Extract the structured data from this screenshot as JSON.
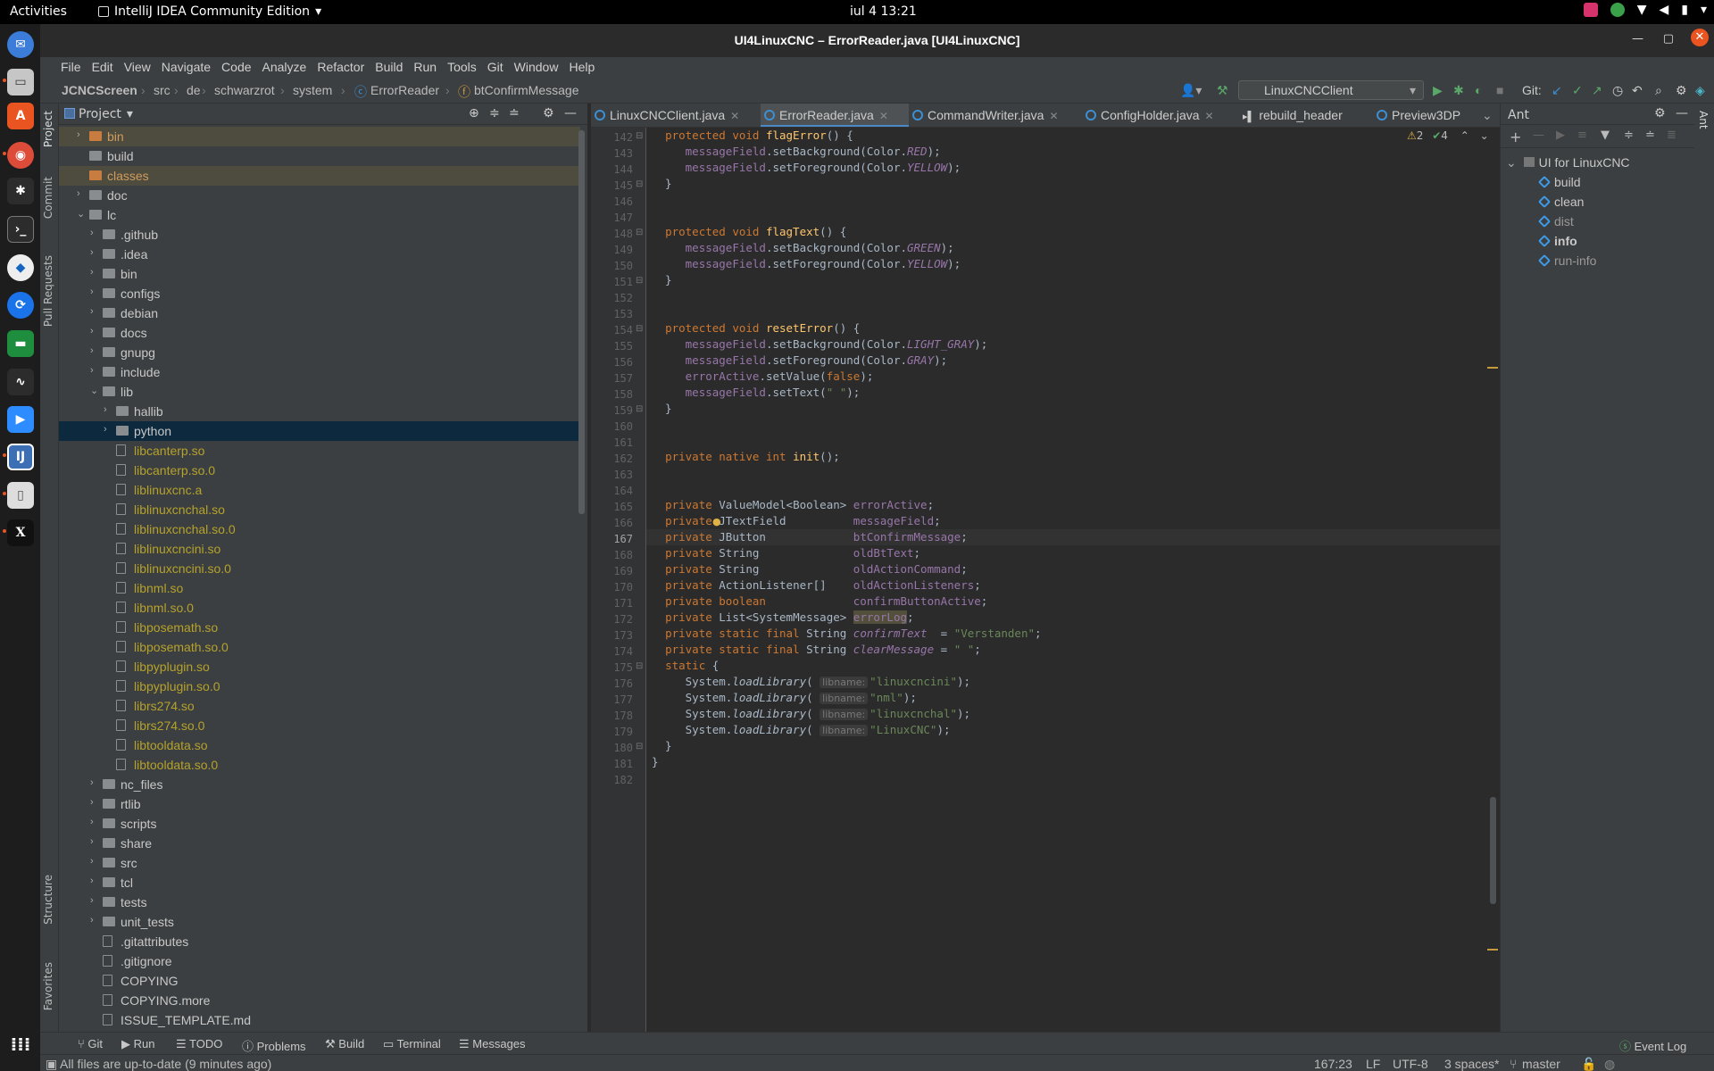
{
  "system": {
    "activities": "Activities",
    "app_name": "IntelliJ IDEA Community Edition",
    "clock": "iul 4  13:21"
  },
  "window": {
    "title": "UI4LinuxCNC – ErrorReader.java [UI4LinuxCNC]"
  },
  "menu": [
    "File",
    "Edit",
    "View",
    "Navigate",
    "Code",
    "Analyze",
    "Refactor",
    "Build",
    "Run",
    "Tools",
    "Git",
    "Window",
    "Help"
  ],
  "breadcrumb": [
    "JCNCScreen",
    "src",
    "de",
    "schwarzrot",
    "system",
    "ErrorReader",
    "btConfirmMessage"
  ],
  "toolbar": {
    "run_config": "LinuxCNCClient",
    "git_label": "Git:"
  },
  "left_tabs": {
    "project": "Project",
    "commit": "Commit",
    "pull_requests": "Pull Requests",
    "structure": "Structure",
    "favorites": "Favorites"
  },
  "project_panel": {
    "title": "Project",
    "rows": [
      {
        "label": "bin",
        "depth": 1,
        "arrow": "›",
        "kind": "folder-ex",
        "style": "excluded"
      },
      {
        "label": "build",
        "depth": 1,
        "arrow": "",
        "kind": "folder",
        "style": ""
      },
      {
        "label": "classes",
        "depth": 1,
        "arrow": "",
        "kind": "folder-ex",
        "style": "excluded"
      },
      {
        "label": "doc",
        "depth": 1,
        "arrow": "›",
        "kind": "folder",
        "style": ""
      },
      {
        "label": "lc",
        "depth": 1,
        "arrow": "⌄",
        "kind": "folder",
        "style": ""
      },
      {
        "label": ".github",
        "depth": 2,
        "arrow": "›",
        "kind": "folder",
        "style": ""
      },
      {
        "label": ".idea",
        "depth": 2,
        "arrow": "›",
        "kind": "folder",
        "style": ""
      },
      {
        "label": "bin",
        "depth": 2,
        "arrow": "›",
        "kind": "folder",
        "style": ""
      },
      {
        "label": "configs",
        "depth": 2,
        "arrow": "›",
        "kind": "folder",
        "style": ""
      },
      {
        "label": "debian",
        "depth": 2,
        "arrow": "›",
        "kind": "folder",
        "style": ""
      },
      {
        "label": "docs",
        "depth": 2,
        "arrow": "›",
        "kind": "folder",
        "style": ""
      },
      {
        "label": "gnupg",
        "depth": 2,
        "arrow": "›",
        "kind": "folder",
        "style": ""
      },
      {
        "label": "include",
        "depth": 2,
        "arrow": "›",
        "kind": "folder",
        "style": ""
      },
      {
        "label": "lib",
        "depth": 2,
        "arrow": "⌄",
        "kind": "folder",
        "style": ""
      },
      {
        "label": "hallib",
        "depth": 3,
        "arrow": "›",
        "kind": "folder",
        "style": ""
      },
      {
        "label": "python",
        "depth": 3,
        "arrow": "›",
        "kind": "folder",
        "style": "selected"
      },
      {
        "label": "libcanterp.so",
        "depth": 3,
        "arrow": "",
        "kind": "file",
        "style": "yellow"
      },
      {
        "label": "libcanterp.so.0",
        "depth": 3,
        "arrow": "",
        "kind": "file",
        "style": "yellow"
      },
      {
        "label": "liblinuxcnc.a",
        "depth": 3,
        "arrow": "",
        "kind": "file",
        "style": "yellow"
      },
      {
        "label": "liblinuxcnchal.so",
        "depth": 3,
        "arrow": "",
        "kind": "file",
        "style": "yellow"
      },
      {
        "label": "liblinuxcnchal.so.0",
        "depth": 3,
        "arrow": "",
        "kind": "file",
        "style": "yellow"
      },
      {
        "label": "liblinuxcncini.so",
        "depth": 3,
        "arrow": "",
        "kind": "file",
        "style": "yellow"
      },
      {
        "label": "liblinuxcncini.so.0",
        "depth": 3,
        "arrow": "",
        "kind": "file",
        "style": "yellow"
      },
      {
        "label": "libnml.so",
        "depth": 3,
        "arrow": "",
        "kind": "file",
        "style": "yellow"
      },
      {
        "label": "libnml.so.0",
        "depth": 3,
        "arrow": "",
        "kind": "file",
        "style": "yellow"
      },
      {
        "label": "libposemath.so",
        "depth": 3,
        "arrow": "",
        "kind": "file",
        "style": "yellow"
      },
      {
        "label": "libposemath.so.0",
        "depth": 3,
        "arrow": "",
        "kind": "file",
        "style": "yellow"
      },
      {
        "label": "libpyplugin.so",
        "depth": 3,
        "arrow": "",
        "kind": "file",
        "style": "yellow"
      },
      {
        "label": "libpyplugin.so.0",
        "depth": 3,
        "arrow": "",
        "kind": "file",
        "style": "yellow"
      },
      {
        "label": "librs274.so",
        "depth": 3,
        "arrow": "",
        "kind": "file",
        "style": "yellow"
      },
      {
        "label": "librs274.so.0",
        "depth": 3,
        "arrow": "",
        "kind": "file",
        "style": "yellow"
      },
      {
        "label": "libtooldata.so",
        "depth": 3,
        "arrow": "",
        "kind": "file",
        "style": "yellow"
      },
      {
        "label": "libtooldata.so.0",
        "depth": 3,
        "arrow": "",
        "kind": "file",
        "style": "yellow"
      },
      {
        "label": "nc_files",
        "depth": 2,
        "arrow": "›",
        "kind": "folder",
        "style": ""
      },
      {
        "label": "rtlib",
        "depth": 2,
        "arrow": "›",
        "kind": "folder",
        "style": ""
      },
      {
        "label": "scripts",
        "depth": 2,
        "arrow": "›",
        "kind": "folder",
        "style": ""
      },
      {
        "label": "share",
        "depth": 2,
        "arrow": "›",
        "kind": "folder",
        "style": ""
      },
      {
        "label": "src",
        "depth": 2,
        "arrow": "›",
        "kind": "folder",
        "style": ""
      },
      {
        "label": "tcl",
        "depth": 2,
        "arrow": "›",
        "kind": "folder",
        "style": ""
      },
      {
        "label": "tests",
        "depth": 2,
        "arrow": "›",
        "kind": "folder",
        "style": ""
      },
      {
        "label": "unit_tests",
        "depth": 2,
        "arrow": "›",
        "kind": "folder",
        "style": ""
      },
      {
        "label": ".gitattributes",
        "depth": 2,
        "arrow": "",
        "kind": "file",
        "style": ""
      },
      {
        "label": ".gitignore",
        "depth": 2,
        "arrow": "",
        "kind": "file",
        "style": ""
      },
      {
        "label": "COPYING",
        "depth": 2,
        "arrow": "",
        "kind": "file",
        "style": ""
      },
      {
        "label": "COPYING.more",
        "depth": 2,
        "arrow": "",
        "kind": "file",
        "style": ""
      },
      {
        "label": "ISSUE_TEMPLATE.md",
        "depth": 2,
        "arrow": "",
        "kind": "file",
        "style": ""
      }
    ]
  },
  "editor_tabs": [
    {
      "label": "LinuxCNCClient.java",
      "active": false
    },
    {
      "label": "ErrorReader.java",
      "active": true
    },
    {
      "label": "CommandWriter.java",
      "active": false
    },
    {
      "label": "ConfigHolder.java",
      "active": false
    },
    {
      "label": "rebuild_header",
      "active": false
    },
    {
      "label": "Preview3DP",
      "active": false
    }
  ],
  "inspections": {
    "warnings": "2",
    "ok": "4"
  },
  "editor": {
    "current_line": 167,
    "lines": [
      {
        "n": 142,
        "html": "  <span class='kw'>protected void </span><span class='fn'>flagError</span>() {"
      },
      {
        "n": 143,
        "html": "     <span class='fld'>messageField</span>.setBackground(Color.<span class='fld-i'>RED</span>);"
      },
      {
        "n": 144,
        "html": "     <span class='fld'>messageField</span>.setForeground(Color.<span class='fld-i'>YELLOW</span>);"
      },
      {
        "n": 145,
        "html": "  }"
      },
      {
        "n": 146,
        "html": ""
      },
      {
        "n": 147,
        "html": ""
      },
      {
        "n": 148,
        "html": "  <span class='kw'>protected void </span><span class='fn'>flagText</span>() {"
      },
      {
        "n": 149,
        "html": "     <span class='fld'>messageField</span>.setBackground(Color.<span class='fld-i'>GREEN</span>);"
      },
      {
        "n": 150,
        "html": "     <span class='fld'>messageField</span>.setForeground(Color.<span class='fld-i'>YELLOW</span>);"
      },
      {
        "n": 151,
        "html": "  }"
      },
      {
        "n": 152,
        "html": ""
      },
      {
        "n": 153,
        "html": ""
      },
      {
        "n": 154,
        "html": "  <span class='kw'>protected void </span><span class='fn'>resetError</span>() {"
      },
      {
        "n": 155,
        "html": "     <span class='fld'>messageField</span>.setBackground(Color.<span class='fld-i'>LIGHT_GRAY</span>);"
      },
      {
        "n": 156,
        "html": "     <span class='fld'>messageField</span>.setForeground(Color.<span class='fld-i'>GRAY</span>);"
      },
      {
        "n": 157,
        "html": "     <span class='fld'>errorActive</span>.setValue(<span class='kw'>false</span>);"
      },
      {
        "n": 158,
        "html": "     <span class='fld'>messageField</span>.setText(<span class='st'>\" \"</span>);"
      },
      {
        "n": 159,
        "html": "  }"
      },
      {
        "n": 160,
        "html": ""
      },
      {
        "n": 161,
        "html": ""
      },
      {
        "n": 162,
        "html": "  <span class='kw'>private native int </span><span class='fn'>init</span>();"
      },
      {
        "n": 163,
        "html": ""
      },
      {
        "n": 164,
        "html": ""
      },
      {
        "n": 165,
        "html": "  <span class='kw'>private </span>ValueModel&lt;Boolean&gt; <span class='fld'>errorActive</span>;"
      },
      {
        "n": 166,
        "html": "  <span class='kw'>private </span>JTextField          <span class='fld'>messageField</span>;"
      },
      {
        "n": 167,
        "html": "  <span class='kw'>private </span>JButton             <span class='fld'>btConfirmMessage</span>;"
      },
      {
        "n": 168,
        "html": "  <span class='kw'>private </span>String              <span class='fld'>oldBtText</span>;"
      },
      {
        "n": 169,
        "html": "  <span class='kw'>private </span>String              <span class='fld'>oldActionCommand</span>;"
      },
      {
        "n": 170,
        "html": "  <span class='kw'>private </span>ActionListener[]    <span class='fld'>oldActionListeners</span>;"
      },
      {
        "n": 171,
        "html": "  <span class='kw'>private boolean             </span><span class='fld'>confirmButtonActive</span>;"
      },
      {
        "n": 172,
        "html": "  <span class='kw'>private </span>List&lt;SystemMessage&gt; <span class='fld gold-box'>errorLog</span>;"
      },
      {
        "n": 173,
        "html": "  <span class='kw'>private static final </span>String <span class='fld-i'>confirmText</span>  = <span class='st'>\"Verstanden\"</span>;"
      },
      {
        "n": 174,
        "html": "  <span class='kw'>private static final </span>String <span class='fld-i'>clearMessage</span> = <span class='st'>\" \"</span>;"
      },
      {
        "n": 175,
        "html": "  <span class='kw'>static </span>{"
      },
      {
        "n": 176,
        "html": "     System.<span class='mi-i'>loadLibrary</span>( <span class='hint'>libname:</span><span class='st'>\"linuxcncini\"</span>);"
      },
      {
        "n": 177,
        "html": "     System.<span class='mi-i'>loadLibrary</span>( <span class='hint'>libname:</span><span class='st'>\"nml\"</span>);"
      },
      {
        "n": 178,
        "html": "     System.<span class='mi-i'>loadLibrary</span>( <span class='hint'>libname:</span><span class='st'>\"linuxcnchal\"</span>);"
      },
      {
        "n": 179,
        "html": "     System.<span class='mi-i'>loadLibrary</span>( <span class='hint'>libname:</span><span class='st'>\"LinuxCNC\"</span>);"
      },
      {
        "n": 180,
        "html": "  }"
      },
      {
        "n": 181,
        "html": "}"
      },
      {
        "n": 182,
        "html": ""
      }
    ]
  },
  "ant_panel": {
    "title": "Ant",
    "root": "UI for LinuxCNC",
    "targets": [
      "build",
      "clean",
      "dist",
      "info",
      "run-info"
    ],
    "bold_target": "info"
  },
  "bottom_tools": [
    "Git",
    "Run",
    "TODO",
    "Problems",
    "Build",
    "Terminal",
    "Messages"
  ],
  "event_log": "Event Log",
  "status": {
    "message": "All files are up-to-date (9 minutes ago)",
    "position": "167:23",
    "line_sep": "LF",
    "encoding": "UTF-8",
    "indent": "3 spaces*",
    "branch": "master"
  },
  "colors": {
    "accent": "#4a88c7",
    "close": "#e95420",
    "keyword": "#cc7832",
    "field": "#9876aa",
    "string": "#6a8759",
    "method": "#ffc66d"
  }
}
